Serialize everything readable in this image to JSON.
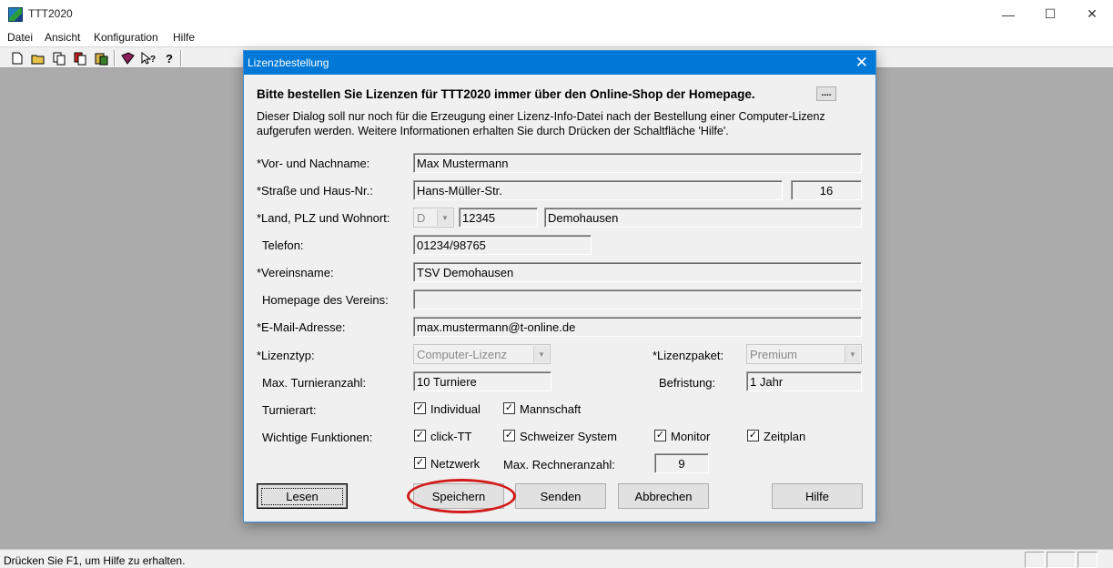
{
  "app": {
    "title": "TTT2020",
    "window_controls": {
      "minimize": "—",
      "maximize": "☐",
      "close": "✕"
    },
    "menu": [
      "Datei",
      "Ansicht",
      "Konfiguration",
      "Hilfe"
    ],
    "toolbar_icons": [
      "new-file-icon",
      "open-folder-icon",
      "copy-icon",
      "cut-icon",
      "paste-icon",
      "book-icon",
      "context-help-icon",
      "help-icon"
    ],
    "status_text": "Drücken Sie F1, um Hilfe zu erhalten."
  },
  "dialog": {
    "title": "Lizenzbestellung",
    "close_glyph": "✕",
    "headline": "Bitte bestellen Sie Lizenzen für TTT2020 immer über den Online-Shop der Homepage.",
    "ellipsis_button": "....",
    "info_line1": "Dieser Dialog soll nur noch für die Erzeugung einer Lizenz-Info-Datei nach der Bestellung einer Computer-Lizenz",
    "info_line2": "aufgerufen werden. Weitere Informationen erhalten Sie durch Drücken der Schaltfläche 'Hilfe'.",
    "fields": {
      "name_label": "*Vor- und Nachname:",
      "name_value": "Max Mustermann",
      "street_label": "*Straße und Haus-Nr.:",
      "street_value": "Hans-Müller-Str.",
      "house_no_value": "16",
      "location_label": "*Land, PLZ und Wohnort:",
      "country_value": "D",
      "zip_value": "12345",
      "city_value": "Demohausen",
      "phone_label": "Telefon:",
      "phone_value": "01234/98765",
      "club_label": "*Vereinsname:",
      "club_value": "TSV Demohausen",
      "homepage_label": "Homepage des Vereins:",
      "homepage_value": "",
      "email_label": "*E-Mail-Adresse:",
      "email_value": "max.mustermann@t-online.de",
      "license_type_label": "*Lizenztyp:",
      "license_type_value": "Computer-Lizenz",
      "license_package_label": "*Lizenzpaket:",
      "license_package_value": "Premium",
      "max_tournaments_label": "Max. Turnieranzahl:",
      "max_tournaments_value": "10 Turniere",
      "term_label": "Befristung:",
      "term_value": "1 Jahr",
      "tournament_type_label": "Turnierart:",
      "important_functions_label": "Wichtige Funktionen:",
      "max_computers_label": "Max. Rechneranzahl:",
      "max_computers_value": "9"
    },
    "checkboxes": {
      "individual": {
        "label": "Individual",
        "checked": true
      },
      "mannschaft": {
        "label": "Mannschaft",
        "checked": true
      },
      "click_tt": {
        "label": "click-TT",
        "checked": true
      },
      "schweizer": {
        "label": "Schweizer System",
        "checked": true
      },
      "monitor": {
        "label": "Monitor",
        "checked": true
      },
      "zeitplan": {
        "label": "Zeitplan",
        "checked": true
      },
      "netzwerk": {
        "label": "Netzwerk",
        "checked": true
      }
    },
    "check_glyph": "✓",
    "buttons": {
      "lesen": "Lesen",
      "speichern": "Speichern",
      "senden": "Senden",
      "abbrechen": "Abbrechen",
      "hilfe": "Hilfe"
    },
    "highlight_color": "#d21a1a"
  }
}
